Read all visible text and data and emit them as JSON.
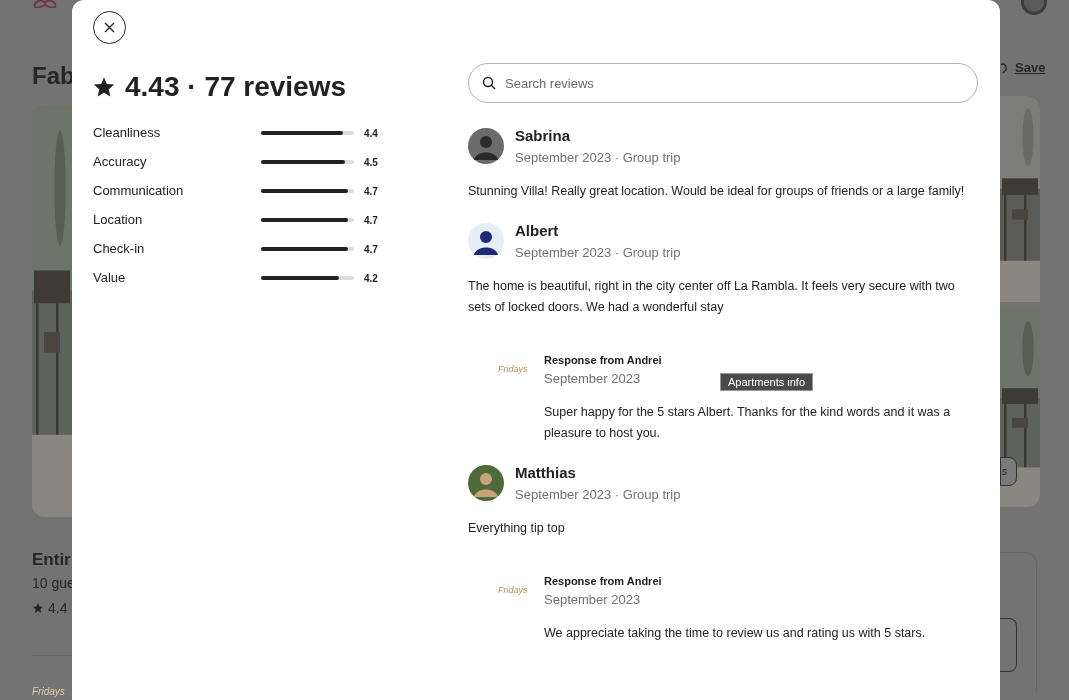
{
  "background_page": {
    "title": "Fab",
    "save_label": "Save",
    "subtitle": "Entir",
    "guests": "10 gue",
    "rating": "4.4",
    "photo_button": "s",
    "host_logo": "Fridays"
  },
  "modal": {
    "heading": "4.43 · 77 reviews",
    "categories": [
      {
        "label": "Cleanliness",
        "level": 0.88,
        "value": "4.4"
      },
      {
        "label": "Accuracy",
        "level": 0.9,
        "value": "4.5"
      },
      {
        "label": "Communication",
        "level": 0.94,
        "value": "4.7"
      },
      {
        "label": "Location",
        "level": 0.94,
        "value": "4.7"
      },
      {
        "label": "Check-in",
        "level": 0.94,
        "value": "4.7"
      },
      {
        "label": "Value",
        "level": 0.84,
        "value": "4.2"
      }
    ],
    "search": {
      "placeholder": "Search reviews"
    },
    "reviews": [
      {
        "name": "Sabrina",
        "meta": "September 2023 · Group trip",
        "text": "Stunning Villa! Really great location. Would be ideal for groups of friends or a large family!"
      },
      {
        "name": "Albert",
        "meta": "September 2023 · Group trip",
        "text": "The home is beautiful, right in the city center off La Rambla. It feels very secure with two sets of locked doors. We had a wonderful stay",
        "response": {
          "logo": "Fridays",
          "title": "Response from Andrei",
          "date": "September 2023",
          "text": "Super happy for the 5 stars Albert. Thanks for the kind words and it was a pleasure to host you."
        }
      },
      {
        "name": "Matthias",
        "meta": "September 2023 · Group trip",
        "text": "Everything tip top",
        "response": {
          "logo": "Fridays",
          "title": "Response from Andrei",
          "date": "September 2023",
          "text": "We appreciate taking the time to review us and rating us with 5 stars."
        }
      }
    ],
    "tooltip": "Apartments info"
  }
}
